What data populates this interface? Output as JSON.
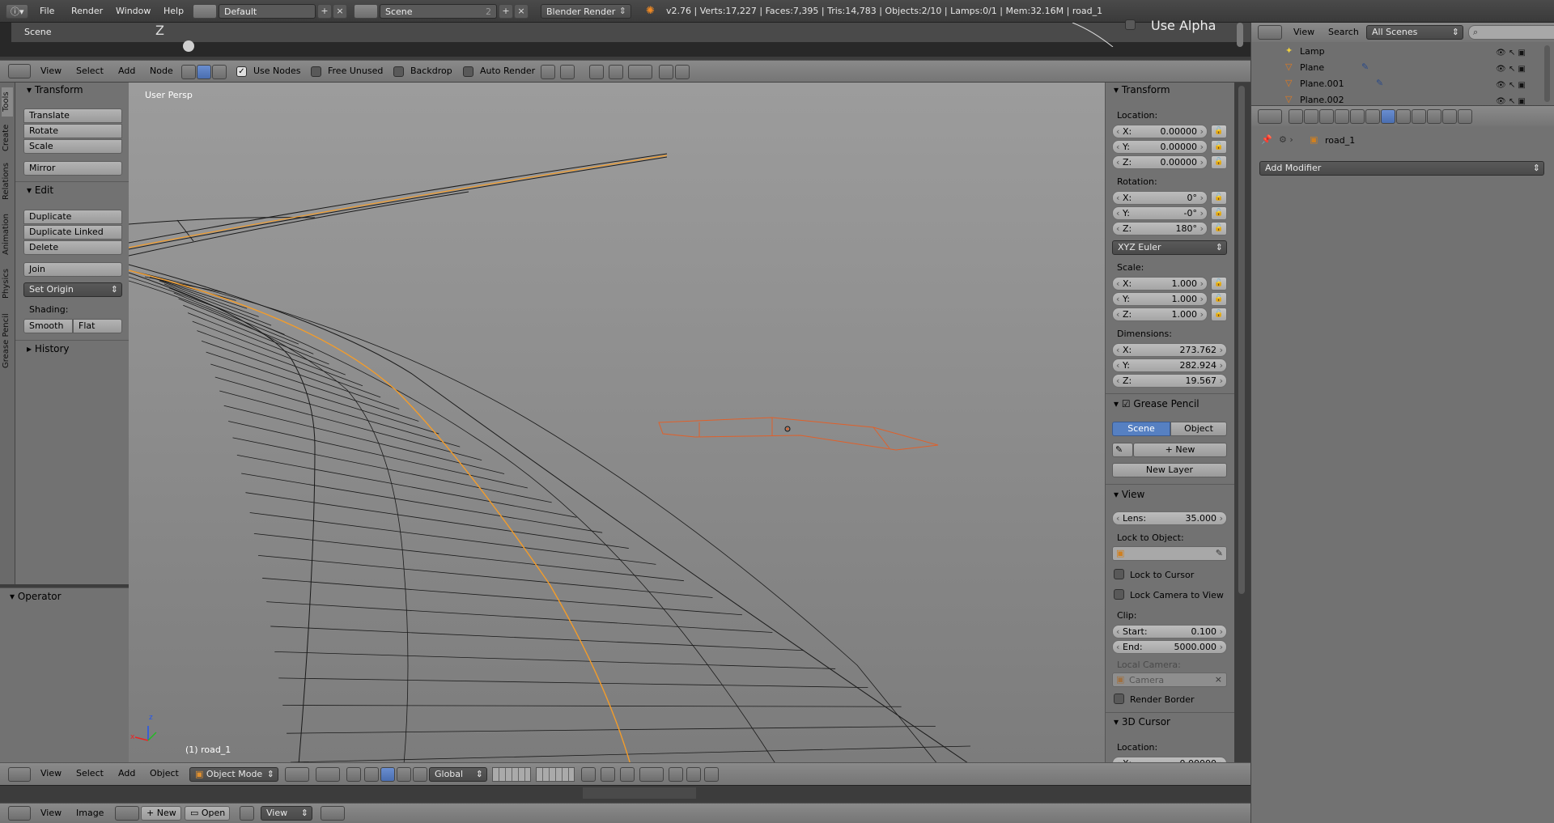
{
  "topbar": {
    "menus": [
      "File",
      "Render",
      "Window",
      "Help"
    ],
    "layout": "Default",
    "scene": "Scene",
    "scene_num": "2",
    "engine": "Blender Render",
    "stats": "v2.76 | Verts:17,227 | Faces:7,395 | Tris:14,783 | Objects:2/10 | Lamps:0/1 | Mem:32.16M | road_1"
  },
  "node_strip": {
    "scene_label": "Scene",
    "axis_label": "Z",
    "use_alpha": "Use Alpha"
  },
  "node_header": {
    "menus": [
      "View",
      "Select",
      "Add",
      "Node"
    ],
    "use_nodes": "Use Nodes",
    "free_unused": "Free Unused",
    "backdrop": "Backdrop",
    "auto_render": "Auto Render"
  },
  "tabs": [
    "Tools",
    "Create",
    "Relations",
    "Animation",
    "Physics",
    "Grease Pencil"
  ],
  "tools": {
    "transform_title": "Transform",
    "translate": "Translate",
    "rotate": "Rotate",
    "scale": "Scale",
    "mirror": "Mirror",
    "edit_title": "Edit",
    "duplicate": "Duplicate",
    "duplicate_linked": "Duplicate Linked",
    "delete": "Delete",
    "join": "Join",
    "set_origin": "Set Origin",
    "shading_label": "Shading:",
    "smooth": "Smooth",
    "flat": "Flat",
    "history_title": "History",
    "operator_title": "Operator"
  },
  "viewport": {
    "persp_label": "User Persp",
    "object_label": "(1) road_1",
    "accent": "#f39c2a",
    "selected_outline": "#e0602a"
  },
  "props": {
    "transform_title": "Transform",
    "location_label": "Location:",
    "loc": [
      {
        "k": "X:",
        "v": "0.00000"
      },
      {
        "k": "Y:",
        "v": "0.00000"
      },
      {
        "k": "Z:",
        "v": "0.00000"
      }
    ],
    "rotation_label": "Rotation:",
    "rot": [
      {
        "k": "X:",
        "v": "0°"
      },
      {
        "k": "Y:",
        "v": "-0°"
      },
      {
        "k": "Z:",
        "v": "180°"
      }
    ],
    "rotation_mode": "XYZ Euler",
    "scale_label": "Scale:",
    "scl": [
      {
        "k": "X:",
        "v": "1.000"
      },
      {
        "k": "Y:",
        "v": "1.000"
      },
      {
        "k": "Z:",
        "v": "1.000"
      }
    ],
    "dimensions_label": "Dimensions:",
    "dim": [
      {
        "k": "X:",
        "v": "273.762"
      },
      {
        "k": "Y:",
        "v": "282.924"
      },
      {
        "k": "Z:",
        "v": "19.567"
      }
    ],
    "grease_title": "Grease Pencil",
    "gp_scene": "Scene",
    "gp_object": "Object",
    "gp_new": "New",
    "gp_new_layer": "New Layer",
    "view_title": "View",
    "lens_k": "Lens:",
    "lens_v": "35.000",
    "lock_obj_label": "Lock to Object:",
    "lock_cursor": "Lock to Cursor",
    "lock_camera": "Lock Camera to View",
    "clip_label": "Clip:",
    "clip_start_k": "Start:",
    "clip_start_v": "0.100",
    "clip_end_k": "End:",
    "clip_end_v": "5000.000",
    "local_camera_label": "Local Camera:",
    "camera_placeholder": "Camera",
    "render_border": "Render Border",
    "cursor_title": "3D Cursor",
    "cursor_location": "Location:",
    "cursor_x_k": "X:",
    "cursor_x_v": "0.00000"
  },
  "view3d_header": {
    "menus": [
      "View",
      "Select",
      "Add",
      "Object"
    ],
    "mode": "Object Mode",
    "orientation": "Global"
  },
  "image_header": {
    "menus": [
      "View",
      "Image"
    ],
    "new": "New",
    "open": "Open",
    "view": "View"
  },
  "outliner": {
    "menus": [
      "View",
      "Search"
    ],
    "filter": "All Scenes",
    "items": [
      "Lamp",
      "Plane",
      "Plane.001",
      "Plane.002"
    ]
  },
  "properties_editor": {
    "object_name": "road_1",
    "add_modifier": "Add Modifier"
  }
}
